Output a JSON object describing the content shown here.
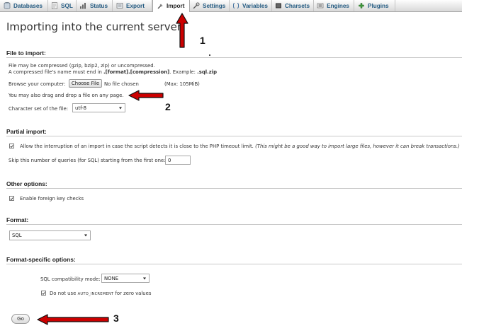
{
  "tabs": [
    {
      "label": "Databases",
      "icon": "database-icon"
    },
    {
      "label": "SQL",
      "icon": "sql-icon"
    },
    {
      "label": "Status",
      "icon": "status-icon"
    },
    {
      "label": "Export",
      "icon": "export-icon"
    },
    {
      "label": "Import",
      "icon": "import-icon",
      "active": true
    },
    {
      "label": "Settings",
      "icon": "wrench-icon"
    },
    {
      "label": "Variables",
      "icon": "variables-icon"
    },
    {
      "label": "Charsets",
      "icon": "charsets-icon"
    },
    {
      "label": "Engines",
      "icon": "engines-icon"
    },
    {
      "label": "Plugins",
      "icon": "plugins-icon"
    }
  ],
  "page": {
    "title": "Importing into the current server"
  },
  "file_to_import": {
    "heading": "File to import:",
    "note1": "File may be compressed (gzip, bzip2, zip) or uncompressed.",
    "note2_prefix": "A compressed file's name must end in ",
    "note2_format": ".[format].[compression]",
    "note2_mid": ". Example: ",
    "note2_example": ".sql.zip",
    "browse_label": "Browse your computer:",
    "choose_file_button": "Choose File",
    "no_file_text": "No file chosen",
    "max_size": "(Max: 105MiB)",
    "drag_drop_note": "You may also drag and drop a file on any page.",
    "charset_label": "Character set of the file:",
    "charset_value": "utf-8"
  },
  "partial_import": {
    "heading": "Partial import:",
    "allow_interrupt_label": "Allow the interruption of an import in case the script detects it is close to the PHP timeout limit.",
    "allow_interrupt_hint": "(This might be a good way to import large files, however it can break transactions.)",
    "allow_interrupt_checked": true,
    "skip_label": "Skip this number of queries (for SQL) starting from the first one:",
    "skip_value": "0"
  },
  "other_options": {
    "heading": "Other options:",
    "foreign_key_label": "Enable foreign key checks",
    "foreign_key_checked": true
  },
  "format": {
    "heading": "Format:",
    "value": "SQL"
  },
  "format_specific": {
    "heading": "Format-specific options:",
    "compat_label": "SQL compatibility mode:",
    "compat_value": "NONE",
    "auto_inc_prefix": "Do not use ",
    "auto_inc_keyword": "AUTO_INCREMENT",
    "auto_inc_suffix": " for zero values",
    "auto_inc_checked": true
  },
  "go_button": "Go",
  "annotations": {
    "one": "1",
    "two": "2",
    "three": "3",
    "arrow_color": "#cc0000"
  },
  "colors": {
    "tab_text": "#235a81",
    "rule": "#c8c8c8"
  }
}
